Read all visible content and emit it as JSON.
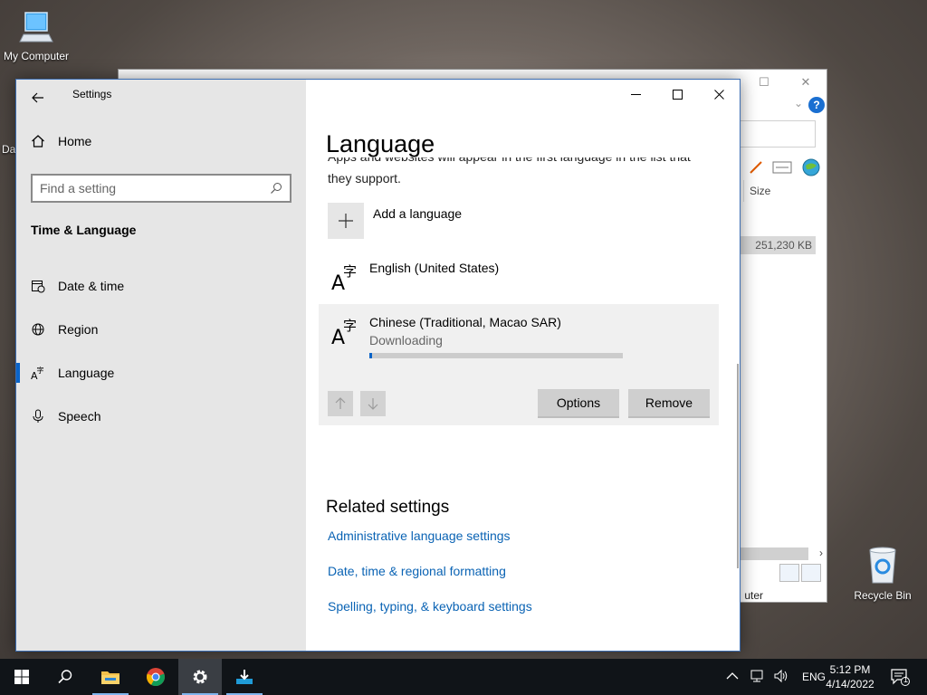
{
  "desktop": {
    "icons": [
      {
        "label": "My Computer"
      },
      {
        "label": "Recycle Bin"
      }
    ],
    "partial_label": "Da"
  },
  "explorer": {
    "column_size": "Size",
    "row_size": "251,230 KB",
    "status_partial": "uter"
  },
  "settings": {
    "window_title": "Settings",
    "sidebar": {
      "home": "Home",
      "search_placeholder": "Find a setting",
      "section": "Time & Language",
      "items": [
        {
          "label": "Date & time",
          "icon": "calendar-clock-icon"
        },
        {
          "label": "Region",
          "icon": "globe-icon"
        },
        {
          "label": "Language",
          "icon": "language-icon",
          "active": true
        },
        {
          "label": "Speech",
          "icon": "microphone-icon"
        }
      ]
    },
    "main": {
      "title": "Language",
      "cut_text": "Apps and websites will appear in the first language in the list that",
      "support_text": "they support.",
      "add_language": "Add a language",
      "languages": [
        {
          "name": "English (United States)"
        },
        {
          "name": "Chinese (Traditional, Macao SAR)",
          "status": "Downloading",
          "progress": 0.01
        }
      ],
      "options_button": "Options",
      "remove_button": "Remove",
      "related_title": "Related settings",
      "links": [
        "Administrative language settings",
        "Date, time & regional formatting",
        "Spelling, typing, & keyboard settings"
      ]
    }
  },
  "taskbar": {
    "language": "ENG",
    "time": "5:12 PM",
    "date": "4/14/2022",
    "notification_count": "1"
  },
  "colors": {
    "accent": "#0a64c8",
    "link": "#0a63b4",
    "taskbar": "#101418"
  }
}
